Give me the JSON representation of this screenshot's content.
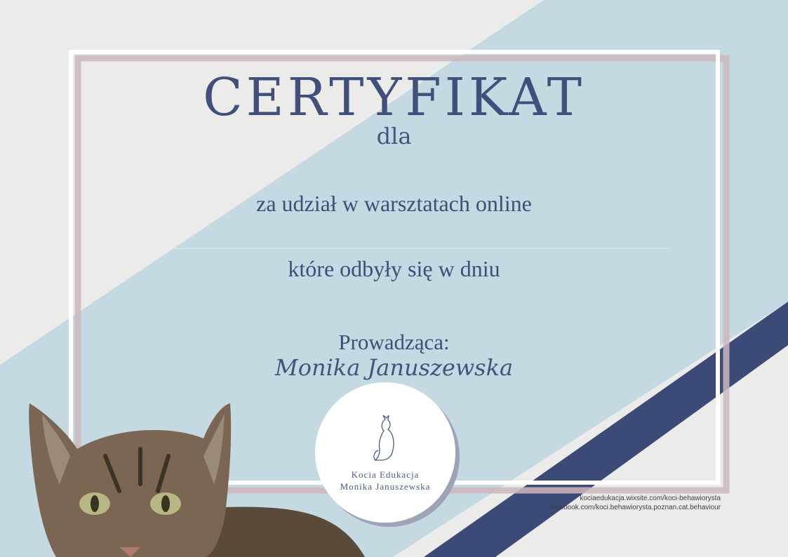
{
  "certificate": {
    "title": "CERTYFIKAT",
    "for": "dla",
    "line1": "za udział w warsztatach online",
    "line2": "które odbyły się w dniu",
    "instructor_label": "Prowadząca:",
    "instructor_name": "Monika Januszewska"
  },
  "logo": {
    "line1": "Kocia Edukacja",
    "line2": "Monika Januszewska",
    "icon": "cat-icon"
  },
  "links": {
    "website": "kociaedukacja.wixsite.com/koci-behawiorysta",
    "facebook": "facebook.com/koci.behawiorysta.poznan.cat.behaviour"
  },
  "colors": {
    "paper": "#ebebea",
    "light_blue": "#c5d9e3",
    "navy": "#3c4a77",
    "text": "#3e4e78"
  }
}
